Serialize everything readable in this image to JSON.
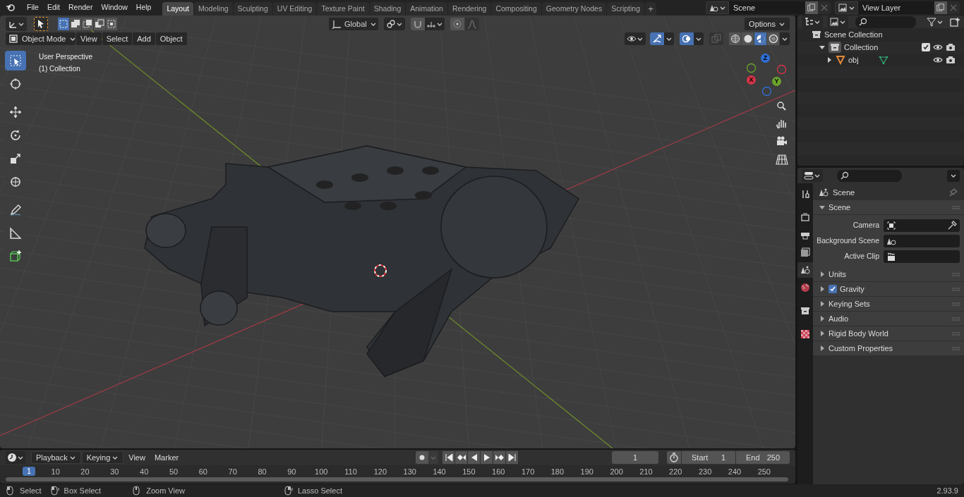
{
  "menu": [
    "File",
    "Edit",
    "Render",
    "Window",
    "Help"
  ],
  "workspaces": [
    {
      "label": "Layout",
      "selected": true
    },
    {
      "label": "Modeling",
      "selected": false
    },
    {
      "label": "Sculpting",
      "selected": false
    },
    {
      "label": "UV Editing",
      "selected": false
    },
    {
      "label": "Texture Paint",
      "selected": false
    },
    {
      "label": "Shading",
      "selected": false
    },
    {
      "label": "Animation",
      "selected": false
    },
    {
      "label": "Rendering",
      "selected": false
    },
    {
      "label": "Compositing",
      "selected": false
    },
    {
      "label": "Geometry Nodes",
      "selected": false
    },
    {
      "label": "Scripting",
      "selected": false
    }
  ],
  "add_workspace": "+",
  "scene_selector": {
    "value": "Scene"
  },
  "view_layer_selector": {
    "value": "View Layer"
  },
  "viewport": {
    "select_modes": [
      {
        "selected": true
      },
      {
        "selected": false
      },
      {
        "selected": false
      },
      {
        "selected": false
      },
      {
        "selected": false
      }
    ],
    "transform_orientation": "Global",
    "options": "Options",
    "mode": "Object Mode",
    "menus": [
      "View",
      "Select",
      "Add",
      "Object"
    ],
    "shading_modes": [
      {
        "selected": false
      },
      {
        "selected": false
      },
      {
        "selected": true
      },
      {
        "selected": false
      }
    ],
    "overlay_text": [
      "User Perspective",
      "(1) Collection"
    ],
    "tools": [
      {
        "selected": true
      },
      {
        "selected": false
      },
      {
        "selected": false
      },
      {
        "selected": false
      },
      {
        "selected": false
      },
      {
        "selected": false
      },
      {
        "selected": false
      },
      {
        "selected": false
      },
      {
        "selected": false
      }
    ],
    "gizmo_axes": [
      "Z",
      "Y",
      "X"
    ]
  },
  "outliner": {
    "items": [
      {
        "label": "Scene Collection",
        "kind": "root",
        "children": [
          {
            "label": "Collection",
            "kind": "collection",
            "expanded": true,
            "checked": true,
            "children": [
              {
                "label": "obj",
                "kind": "object",
                "expanded": false
              }
            ]
          }
        ]
      }
    ]
  },
  "properties": {
    "tabs": [
      {
        "selected": false
      },
      {
        "selected": false
      },
      {
        "selected": false
      },
      {
        "selected": false
      },
      {
        "selected": true
      },
      {
        "selected": false
      },
      {
        "selected": false
      },
      {
        "selected": false
      }
    ],
    "context": "Scene",
    "panels": [
      {
        "title": "Scene",
        "expanded": true,
        "fields": [
          "Camera",
          "Background Scene",
          "Active Clip"
        ]
      },
      {
        "title": "Units",
        "expanded": false
      },
      {
        "title": "Gravity",
        "expanded": false,
        "checked": true
      },
      {
        "title": "Keying Sets",
        "expanded": false
      },
      {
        "title": "Audio",
        "expanded": false
      },
      {
        "title": "Rigid Body World",
        "expanded": false
      },
      {
        "title": "Custom Properties",
        "expanded": false
      }
    ]
  },
  "timeline": {
    "menus": [
      {
        "label": "Playback",
        "dropdown": true
      },
      {
        "label": "Keying",
        "dropdown": true
      },
      {
        "label": "View",
        "dropdown": false
      },
      {
        "label": "Marker",
        "dropdown": false
      }
    ],
    "current_frame": "1",
    "start_label": "Start",
    "start": "1",
    "end_label": "End",
    "end": "250",
    "playhead": "1",
    "ruler": [
      "10",
      "20",
      "30",
      "40",
      "50",
      "60",
      "70",
      "80",
      "90",
      "100",
      "110",
      "120",
      "130",
      "140",
      "150",
      "160",
      "170",
      "180",
      "190",
      "200",
      "210",
      "220",
      "230",
      "240",
      "250"
    ]
  },
  "status_bar": {
    "hints": [
      "Select",
      "Box Select",
      "Zoom View",
      "Lasso Select"
    ],
    "version": "2.93.9"
  }
}
